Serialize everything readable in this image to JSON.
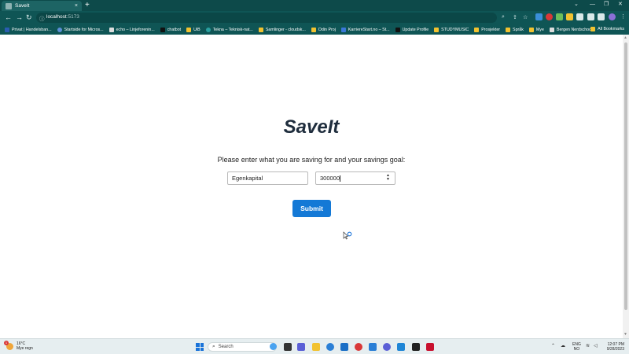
{
  "browser": {
    "tab_title": "SaveIt",
    "tab_close": "×",
    "new_tab": "+",
    "window_controls": [
      "⌄",
      "—",
      "❐",
      "✕"
    ],
    "url_host": "localhost",
    "url_port": ":5173",
    "bookmarks": [
      {
        "label": "Privat | Handelsban...",
        "icon": "bank-icon",
        "color": "#2a5db0"
      },
      {
        "label": "Startside for Micros...",
        "icon": "microsoft-icon",
        "color": "#5c8fd6"
      },
      {
        "label": "echo – Linjeforenin...",
        "icon": "echo-icon",
        "color": "#dddddd"
      },
      {
        "label": "chatbot",
        "icon": "chatbot-icon",
        "color": "#111111"
      },
      {
        "label": "UiB",
        "icon": "folder-icon",
        "color": "#f2c230"
      },
      {
        "label": "Tekna – Teknisk-nat...",
        "icon": "tekna-icon",
        "color": "#2aa0a0"
      },
      {
        "label": "Samlinger - cloudsk...",
        "icon": "cloud-icon",
        "color": "#f2c230"
      },
      {
        "label": "Odin Proj",
        "icon": "folder-icon",
        "color": "#f2c230"
      },
      {
        "label": "KarriereStart.no – St...",
        "icon": "karriere-icon",
        "color": "#3a78d8"
      },
      {
        "label": "Update Profile",
        "icon": "profile-icon",
        "color": "#111111"
      },
      {
        "label": "STUDYMUSIC",
        "icon": "folder-icon",
        "color": "#f2c230"
      },
      {
        "label": "Prosjekter",
        "icon": "folder-icon",
        "color": "#f2c230"
      },
      {
        "label": "Språk",
        "icon": "folder-icon",
        "color": "#f2c230"
      },
      {
        "label": "Mye",
        "icon": "folder-icon",
        "color": "#f2c230"
      },
      {
        "label": "Bergen Nerdschool",
        "icon": "nerdschool-icon",
        "color": "#dddddd"
      }
    ],
    "all_bookmarks": "All Bookmarks"
  },
  "app": {
    "title": "SaveIt",
    "prompt": "Please enter what you are saving for and your savings goal:",
    "goal_name_value": "Egenkapital",
    "goal_amount_value": "300000",
    "submit_label": "Submit",
    "accent_color": "#1479d6"
  },
  "taskbar": {
    "weather_temp": "16°C",
    "weather_desc": "Mye regn",
    "weather_badge": "1",
    "search_label": "Search",
    "lang_line1": "ENG",
    "lang_line2": "NO",
    "time": "12:07 PM",
    "date": "9/28/2023"
  }
}
